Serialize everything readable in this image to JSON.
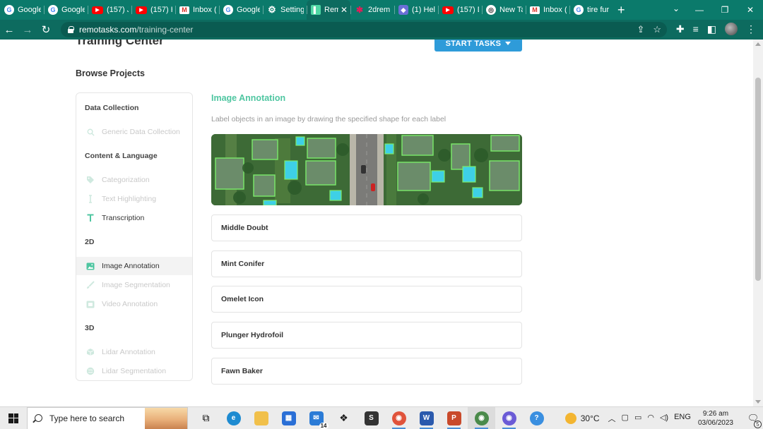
{
  "browser": {
    "tabs": [
      {
        "title": "Google",
        "icon": "google-icon"
      },
      {
        "title": "Google",
        "icon": "google-icon"
      },
      {
        "title": "(157) J",
        "icon": "youtube-icon"
      },
      {
        "title": "(157) H",
        "icon": "youtube-icon"
      },
      {
        "title": "Inbox (",
        "icon": "gmail-icon"
      },
      {
        "title": "Google",
        "icon": "google-icon"
      },
      {
        "title": "Setting",
        "icon": "gear-icon"
      },
      {
        "title": "Rem",
        "icon": "remotasks-icon",
        "active": true
      },
      {
        "title": "2drem",
        "icon": "slack-icon"
      },
      {
        "title": "(1) Hel",
        "icon": "shield-icon"
      },
      {
        "title": "(157) D",
        "icon": "youtube-icon"
      },
      {
        "title": "New Ta",
        "icon": "chrome-icon"
      },
      {
        "title": "Inbox (",
        "icon": "gmail-icon"
      },
      {
        "title": "tire fur",
        "icon": "google-icon"
      }
    ],
    "url_host": "remotasks.com",
    "url_path": "/training-center"
  },
  "page": {
    "title": "Training Center",
    "start_button": "START TASKS",
    "browse_heading": "Browse Projects"
  },
  "sidebar": {
    "sections": [
      {
        "label": "Data Collection",
        "items": [
          {
            "label": "Generic Data Collection",
            "icon": "search-icon",
            "enabled": false
          }
        ]
      },
      {
        "label": "Content & Language",
        "items": [
          {
            "label": "Categorization",
            "icon": "tag-icon",
            "enabled": false
          },
          {
            "label": "Text Highlighting",
            "icon": "text-cursor-icon",
            "enabled": false
          },
          {
            "label": "Transcription",
            "icon": "text-t-icon",
            "enabled": true
          }
        ]
      },
      {
        "label": "2D",
        "items": [
          {
            "label": "Image Annotation",
            "icon": "image-icon",
            "enabled": true,
            "selected": true
          },
          {
            "label": "Image Segmentation",
            "icon": "brush-icon",
            "enabled": false
          },
          {
            "label": "Video Annotation",
            "icon": "film-icon",
            "enabled": false
          }
        ]
      },
      {
        "label": "3D",
        "items": [
          {
            "label": "Lidar Annotation",
            "icon": "cube-icon",
            "enabled": false
          },
          {
            "label": "Lidar Segmentation",
            "icon": "globe-icon",
            "enabled": false
          }
        ]
      }
    ]
  },
  "main": {
    "heading": "Image Annotation",
    "description": "Label objects in an image by drawing the specified shape for each label",
    "projects": [
      "Middle Doubt",
      "Mint Conifer",
      "Omelet Icon",
      "Plunger Hydrofoil",
      "Fawn Baker"
    ]
  },
  "taskbar": {
    "search_placeholder": "Type here to search",
    "mail_badge": "14",
    "weather": "30°C",
    "language": "ENG",
    "time": "9:26 am",
    "date": "03/06/2023",
    "notifications": "5"
  },
  "colors": {
    "accent_green": "#4fc6a1",
    "button_blue": "#2e9bd9",
    "chrome_teal": "#0b7a6b"
  }
}
